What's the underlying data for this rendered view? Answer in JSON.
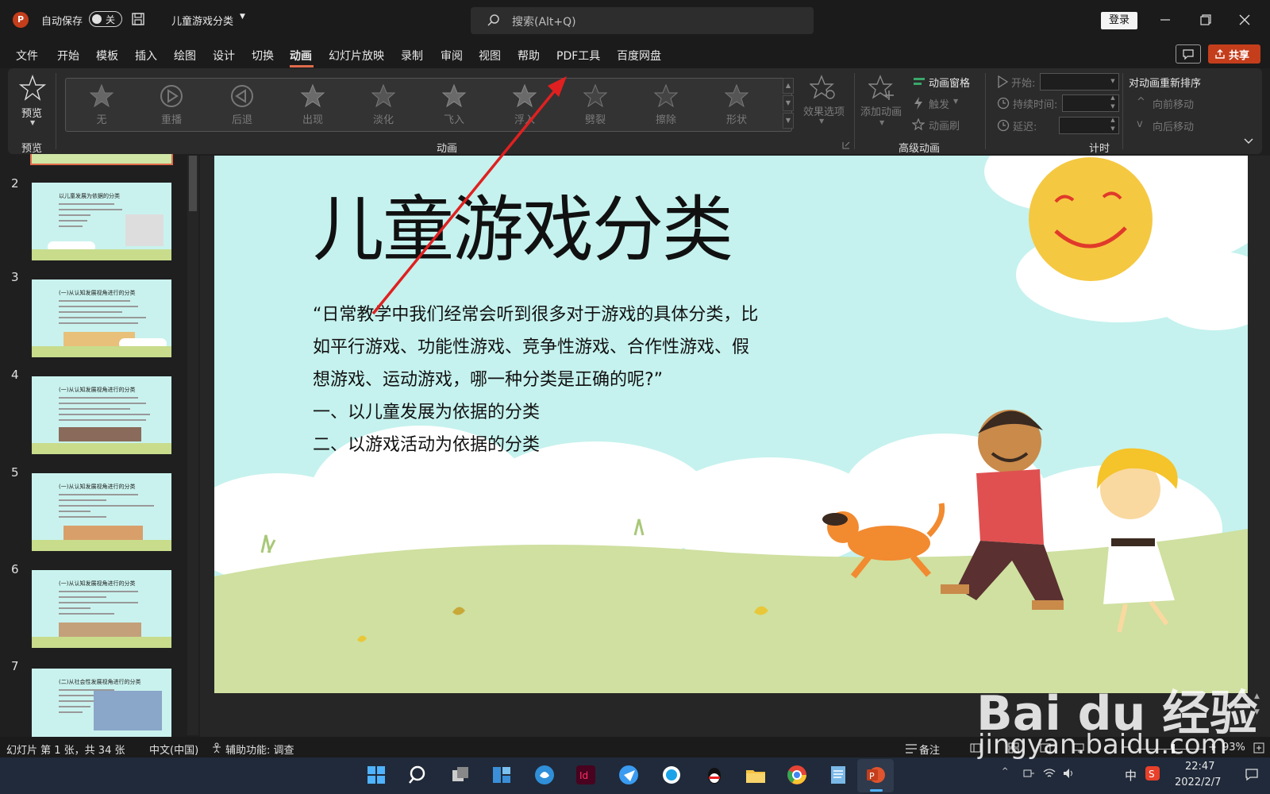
{
  "titlebar": {
    "app_logo": "P",
    "autosave_label": "自动保存",
    "autosave_state": "关",
    "doc_title": "儿童游戏分类",
    "search_placeholder": "搜索(Alt+Q)",
    "login_label": "登录"
  },
  "menu": {
    "tabs": [
      "文件",
      "开始",
      "模板",
      "插入",
      "绘图",
      "设计",
      "切换",
      "动画",
      "幻灯片放映",
      "录制",
      "审阅",
      "视图",
      "帮助",
      "PDF工具",
      "百度网盘"
    ],
    "active_tab": "动画",
    "share_label": "共享"
  },
  "ribbon": {
    "preview_label": "预览",
    "preview_group": "预览",
    "animation_group": "动画",
    "animations": [
      "无",
      "重播",
      "后退",
      "出现",
      "淡化",
      "飞入",
      "浮入",
      "劈裂",
      "擦除",
      "形状"
    ],
    "effect_options_label": "效果选项",
    "add_animation_label": "添加动画",
    "animation_pane_label": "动画窗格",
    "trigger_label": "触发",
    "animation_painter_label": "动画刷",
    "advanced_group": "高级动画",
    "start_label": "开始:",
    "duration_label": "持续时间:",
    "delay_label": "延迟:",
    "timing_group": "计时",
    "reorder_title": "对动画重新排序",
    "move_earlier": "向前移动",
    "move_later": "向后移动"
  },
  "thumbnails": [
    {
      "num": "2",
      "title": "以儿童发展为依据的分类"
    },
    {
      "num": "3",
      "title": "(一)从认知发展视角进行的分类"
    },
    {
      "num": "4",
      "title": "(一)从认知发展视角进行的分类"
    },
    {
      "num": "5",
      "title": "(一)从认知发展视角进行的分类"
    },
    {
      "num": "6",
      "title": "(一)从认知发展视角进行的分类"
    },
    {
      "num": "7",
      "title": "(二)从社会性发展视角进行的分类"
    }
  ],
  "slide": {
    "title": "儿童游戏分类",
    "body_lines": [
      "“日常教学中我们经常会听到很多对于游戏的具体分类，比",
      "如平行游戏、功能性游戏、竞争性游戏、合作性游戏、假",
      "想游戏、运动游戏，哪一种分类是正确的呢?”",
      "一、以儿童发展为依据的分类",
      "二、以游戏活动为依据的分类"
    ]
  },
  "statusbar": {
    "slide_info": "幻灯片 第 1 张，共 34 张",
    "language": "中文(中国)",
    "accessibility": "辅助功能: 调查",
    "notes_label": "备注",
    "zoom": "93%"
  },
  "taskbar": {
    "ime": "中",
    "time": "22:47",
    "date": "2022/2/7"
  },
  "watermark": {
    "logo": "Bai du 经验",
    "url": "jingyan.baidu.com"
  },
  "colors": {
    "accent": "#c43e1c",
    "slide_bg": "#c5f2ee",
    "arrow": "#e02020"
  }
}
